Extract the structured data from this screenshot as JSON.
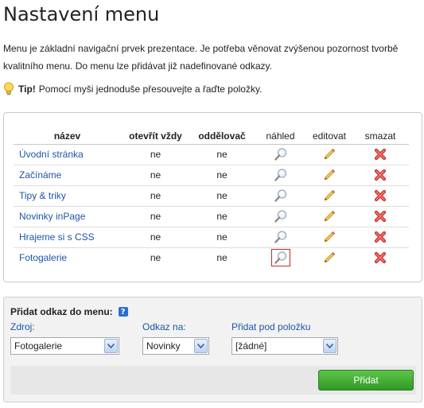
{
  "page": {
    "title": "Nastavení menu",
    "intro": "Menu je základní navigační prvek prezentace. Je potřeba věnovat zvýšenou pozornost tvorbě kvalitního menu. Do menu lze přidávat již nadefinované odkazy."
  },
  "tip": {
    "label": "Tip!",
    "text": "Pomocí myši jednoduše přesouvejte a řaďte položky."
  },
  "menu_table": {
    "headers": {
      "name": "název",
      "open_always": "otevřít vždy",
      "separator": "oddělovač",
      "preview": "náhled",
      "edit": "editovat",
      "delete": "smazat"
    },
    "rows": [
      {
        "name": "Úvodní stránka",
        "open_always": "ne",
        "separator": "ne"
      },
      {
        "name": "Začínáme",
        "open_always": "ne",
        "separator": "ne"
      },
      {
        "name": "Tipy & triky",
        "open_always": "ne",
        "separator": "ne"
      },
      {
        "name": "Novinky inPage",
        "open_always": "ne",
        "separator": "ne"
      },
      {
        "name": "Hrajeme si s CSS",
        "open_always": "ne",
        "separator": "ne"
      },
      {
        "name": "Fotogalerie",
        "open_always": "ne",
        "separator": "ne"
      }
    ]
  },
  "add_form": {
    "title": "Přidat odkaz do menu:",
    "help": "?",
    "source_label": "Zdroj:",
    "source_value": "Fotogalerie",
    "link_label": "Odkaz na:",
    "link_value": "Novinky",
    "parent_label": "Přidat pod položku",
    "parent_value": "[žádné]",
    "submit": "Přidat"
  },
  "icons": {
    "tip": "lightbulb-icon",
    "preview": "magnifier-icon",
    "edit": "pencil-icon",
    "delete": "red-x-icon",
    "dropdown": "chevron-down-icon"
  },
  "colors": {
    "link": "#1d55a8",
    "add_button": "#3aa52e",
    "delete": "#d9534f",
    "highlight_border": "#d3232a"
  }
}
